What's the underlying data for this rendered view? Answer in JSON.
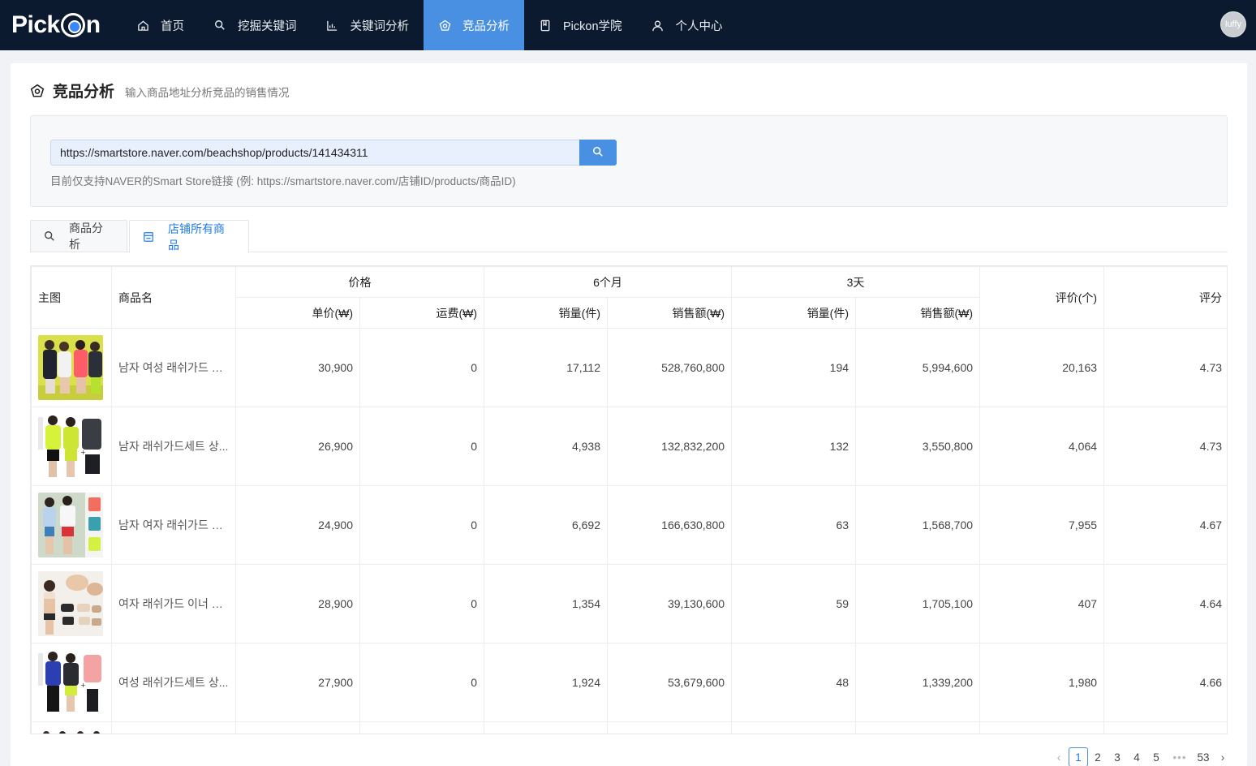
{
  "brand": {
    "logo_left": "Pick",
    "logo_right": "n"
  },
  "nav": {
    "items": [
      {
        "label": "首页",
        "icon": "home-icon"
      },
      {
        "label": "挖掘关键词",
        "icon": "search-icon"
      },
      {
        "label": "关键词分析",
        "icon": "chart-icon"
      },
      {
        "label": "竞品分析",
        "icon": "gem-icon"
      },
      {
        "label": "Pickon学院",
        "icon": "book-icon"
      },
      {
        "label": "个人中心",
        "icon": "user-icon"
      }
    ],
    "active_index": 3,
    "user": "luffy"
  },
  "page": {
    "title": "竞品分析",
    "subtitle": "输入商品地址分析竞品的销售情况"
  },
  "search": {
    "value": "https://smartstore.naver.com/beachshop/products/141434311",
    "hint": "目前仅支持NAVER的Smart Store链接 (例: https://smartstore.naver.com/店铺ID/products/商品ID)"
  },
  "tabs": [
    {
      "label": "商品分析",
      "icon": "search-icon"
    },
    {
      "label": "店铺所有商品",
      "icon": "store-icon"
    }
  ],
  "active_tab": 1,
  "table": {
    "headers": {
      "image": "主图",
      "name": "商品名",
      "price_group": "价格",
      "unit_price": "单价(₩)",
      "shipping": "运费(₩)",
      "six_month_group": "6个月",
      "six_qty": "销量(件)",
      "six_amount": "销售额(₩)",
      "three_day_group": "3天",
      "three_qty": "销量(件)",
      "three_amount": "销售额(₩)",
      "reviews": "评价(个)",
      "rating": "评分"
    },
    "rows": [
      {
        "name": "남자 여성 래쉬가드 루...",
        "price": "30,900",
        "shipping": "0",
        "m6_qty": "17,112",
        "m6_amount": "528,760,800",
        "d3_qty": "194",
        "d3_amount": "5,994,600",
        "reviews": "20,163",
        "rating": "4.73"
      },
      {
        "name": "남자 래쉬가드세트 상...",
        "price": "26,900",
        "shipping": "0",
        "m6_qty": "4,938",
        "m6_amount": "132,832,200",
        "d3_qty": "132",
        "d3_amount": "3,550,800",
        "reviews": "4,064",
        "rating": "4.73"
      },
      {
        "name": "남자 여자 래쉬가드 팬...",
        "price": "24,900",
        "shipping": "0",
        "m6_qty": "6,692",
        "m6_amount": "166,630,800",
        "d3_qty": "63",
        "d3_amount": "1,568,700",
        "reviews": "7,955",
        "rating": "4.67"
      },
      {
        "name": "여자 래쉬가드 이너 세...",
        "price": "28,900",
        "shipping": "0",
        "m6_qty": "1,354",
        "m6_amount": "39,130,600",
        "d3_qty": "59",
        "d3_amount": "1,705,100",
        "reviews": "407",
        "rating": "4.64"
      },
      {
        "name": "여성 래쉬가드세트 상...",
        "price": "27,900",
        "shipping": "0",
        "m6_qty": "1,924",
        "m6_amount": "53,679,600",
        "d3_qty": "48",
        "d3_amount": "1,339,200",
        "reviews": "1,980",
        "rating": "4.66"
      }
    ]
  },
  "pagination": {
    "pages": [
      "1",
      "2",
      "3",
      "4",
      "5"
    ],
    "ellipsis": "•••",
    "last": "53",
    "current": "1"
  }
}
